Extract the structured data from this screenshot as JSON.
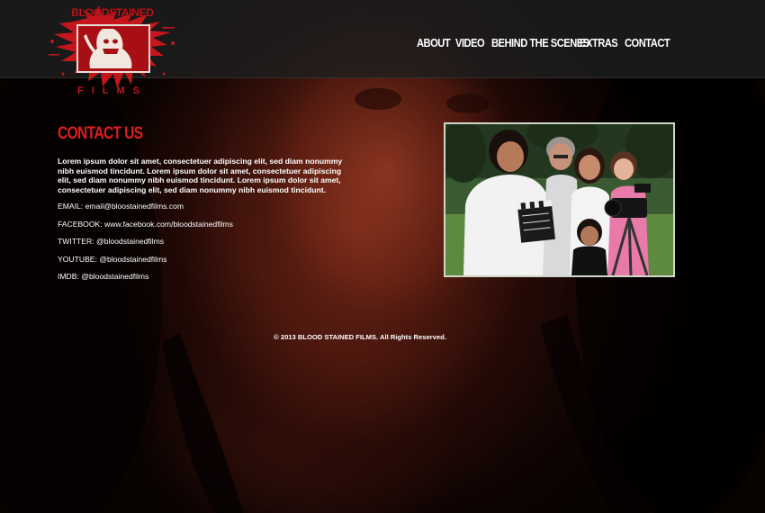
{
  "logo": {
    "top_text": "BLOODSTAINED",
    "bottom_text": "FILMS"
  },
  "nav": {
    "items": [
      {
        "label": "ABOUT"
      },
      {
        "label": "VIDEO"
      },
      {
        "label": "BEHIND THE SCENES"
      },
      {
        "label": "EXTRAS"
      },
      {
        "label": "CONTACT"
      }
    ]
  },
  "main": {
    "title": "CONTACT US",
    "intro": "Lorem ipsum dolor sit amet, consectetuer adipiscing elit, sed diam nonummy nibh euismod tincidunt. Lorem ipsum dolor sit amet, consectetuer adipiscing elit, sed diam nonummy nibh euismod tincidunt. Lorem ipsum dolor sit amet, consectetuer adipiscing elit, sed diam nonummy nibh euismod tincidunt.",
    "email": "EMAIL: email@bloostainedfilms.com",
    "facebook": "FACEBOOK: www.facebook.com/bloodstainedfilms",
    "twitter": "TWITTER: @bloodstainedfilms",
    "youtube": "YOUTUBE: @bloodstainedfilms",
    "imdb": "IMDB: @bloodstainedfilms"
  },
  "footer": {
    "copyright": "© 2013 BLOOD STAINED FILMS. All Rights Reserved."
  },
  "colors": {
    "accent": "#e01e1e",
    "header_bg": "#1e1e1e",
    "text": "#ffffff"
  }
}
